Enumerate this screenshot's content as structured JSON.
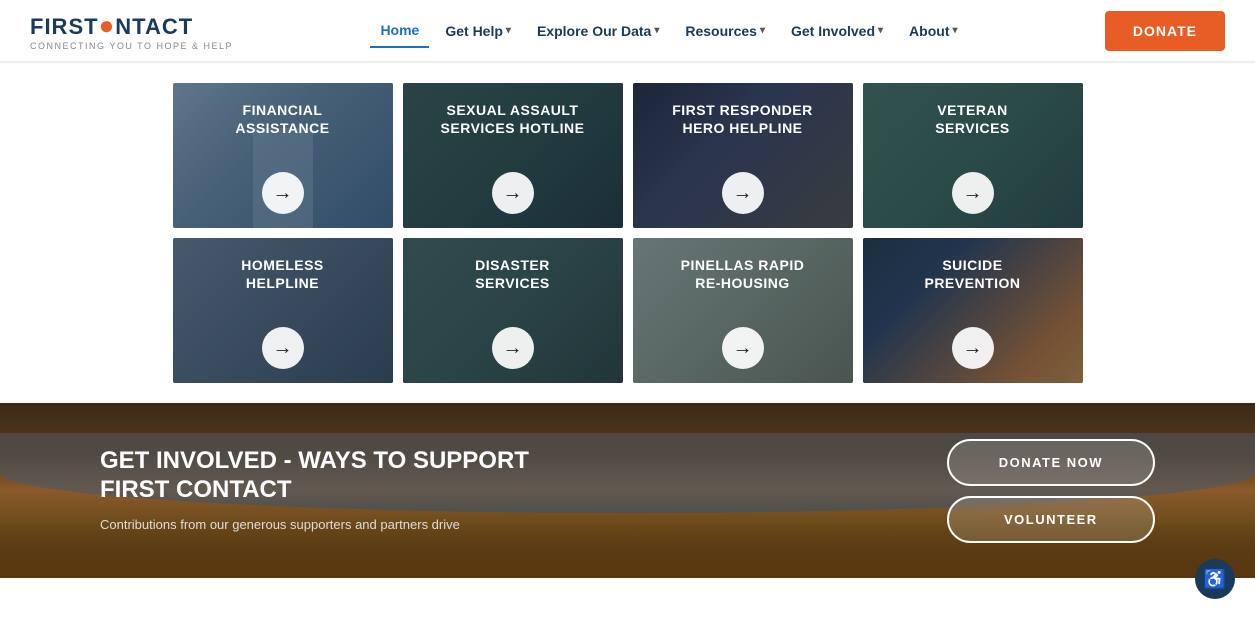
{
  "header": {
    "logo": {
      "text": "FIRSTCONTACT",
      "subtitle": "CONNECTING YOU TO HOPE & HELP"
    },
    "nav": [
      {
        "label": "Home",
        "active": true,
        "hasDropdown": false
      },
      {
        "label": "Get Help",
        "active": false,
        "hasDropdown": true
      },
      {
        "label": "Explore Our Data",
        "active": false,
        "hasDropdown": true
      },
      {
        "label": "Resources",
        "active": false,
        "hasDropdown": true
      },
      {
        "label": "Get Involved",
        "active": false,
        "hasDropdown": true
      },
      {
        "label": "About",
        "active": false,
        "hasDropdown": true
      }
    ],
    "donate_label": "DONATE"
  },
  "cards_row1": [
    {
      "id": "financial",
      "title": "FINANCIAL\nASSISTANCE",
      "class": "card-financial"
    },
    {
      "id": "sexual",
      "title": "SEXUAL ASSAULT\nSERVICES HOTLINE",
      "class": "card-sexual"
    },
    {
      "id": "firstresponder",
      "title": "FIRST RESPONDER\nHERO HELPLINE",
      "class": "card-firstresponder"
    },
    {
      "id": "veteran",
      "title": "VETERAN\nSERVICES",
      "class": "card-veteran"
    }
  ],
  "cards_row2": [
    {
      "id": "homeless",
      "title": "HOMELESS\nHELPLINE",
      "class": "card-homeless"
    },
    {
      "id": "disaster",
      "title": "DISASTER\nSERVICES",
      "class": "card-disaster"
    },
    {
      "id": "pinellas",
      "title": "PINELLAS RAPID\nRE-HOUSING",
      "class": "card-pinellas"
    },
    {
      "id": "suicide",
      "title": "SUICIDE\nPREVENTION",
      "class": "card-suicide"
    }
  ],
  "get_involved": {
    "title": "GET INVOLVED - WAYS TO SUPPORT\nFIRST CONTACT",
    "subtitle": "Contributions from our generous supporters and partners drive",
    "button1": "DONATE NOW",
    "button2": "VOLUNTEER"
  },
  "accessibility": {
    "icon": "♿"
  },
  "arrow_symbol": "→"
}
